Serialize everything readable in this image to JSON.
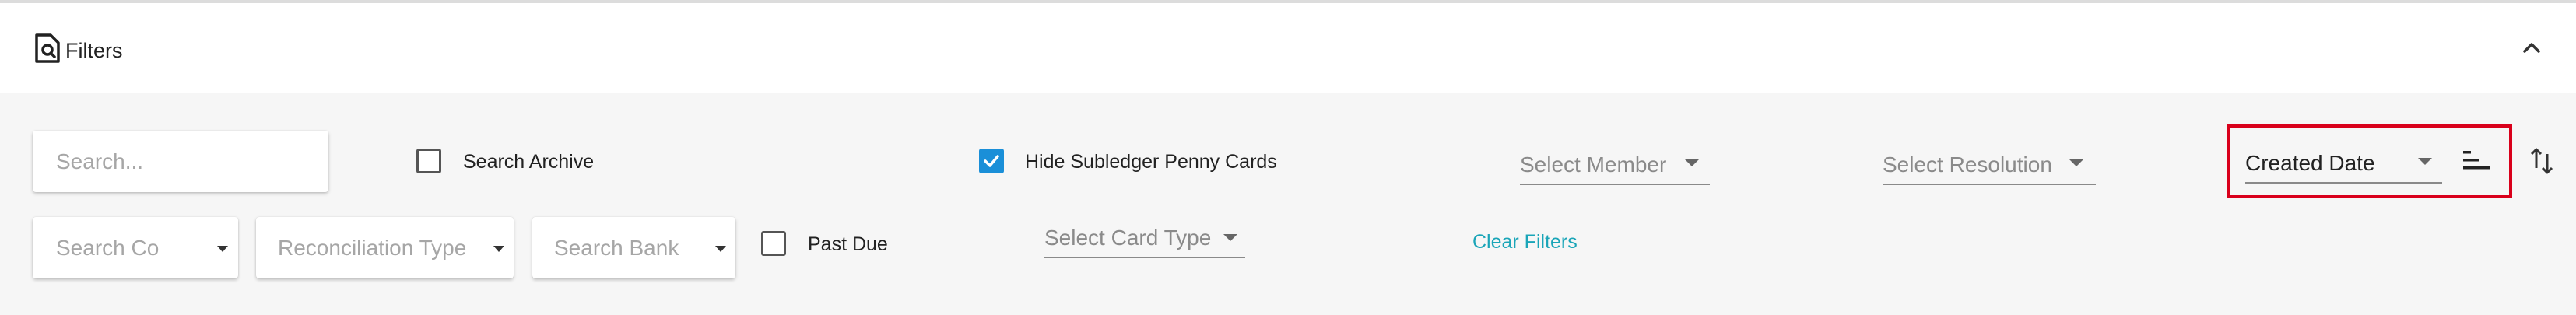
{
  "header": {
    "title": "Filters",
    "filter_icon": "filter-doc-search-icon",
    "collapse_icon": "chevron-up-icon"
  },
  "filters": {
    "search_placeholder": "Search...",
    "search_archive_label": "Search Archive",
    "search_archive_checked": false,
    "hide_penny_label": "Hide Subledger Penny Cards",
    "hide_penny_checked": true,
    "select_member": "Select Member",
    "select_resolution": "Select Resolution",
    "sort_field": "Created Date",
    "sort_icon": "sort-bars-icon",
    "swap_icon": "swap-vertical-icon",
    "search_co": "Search Co",
    "reconciliation_type": "Reconciliation Type",
    "search_bank": "Search Bank",
    "past_due_label": "Past Due",
    "past_due_checked": false,
    "select_card_type": "Select Card Type",
    "clear_filters": "Clear Filters"
  },
  "colors": {
    "accent_checkbox": "#1a8fd8",
    "link": "#1aa5b8",
    "highlight": "#d9001b"
  }
}
